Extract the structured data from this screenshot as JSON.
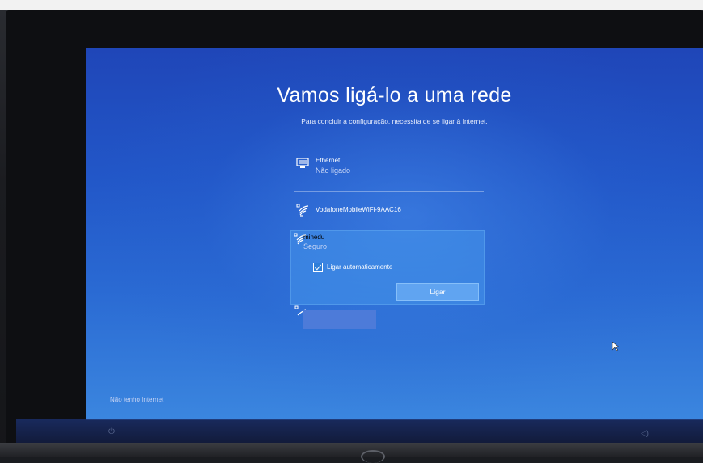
{
  "setup": {
    "title": "Vamos ligá-lo a uma rede",
    "subtitle": "Para concluir a configuração, necessita de se ligar à Internet."
  },
  "networks": [
    {
      "name": "Ethernet",
      "status": "Não ligado",
      "icon": "ethernet-icon"
    },
    {
      "name": "VodafoneMobileWiFi-9AAC16",
      "status": "",
      "icon": "wifi-secured-icon"
    },
    {
      "name": "minedu",
      "status": "Seguro",
      "icon": "wifi-secured-icon",
      "selected": true
    },
    {
      "name": "",
      "status": "",
      "icon": "wifi-secured-icon",
      "redacted": true
    }
  ],
  "selected_network": {
    "auto_connect_label": "Ligar automaticamente",
    "auto_connect_checked": true,
    "connect_button_label": "Ligar"
  },
  "footer": {
    "no_internet_label": "Não tenho Internet"
  },
  "colors": {
    "background_top": "#1f46b8",
    "background_bottom": "#3b86df",
    "selection": "#4a96e8"
  }
}
